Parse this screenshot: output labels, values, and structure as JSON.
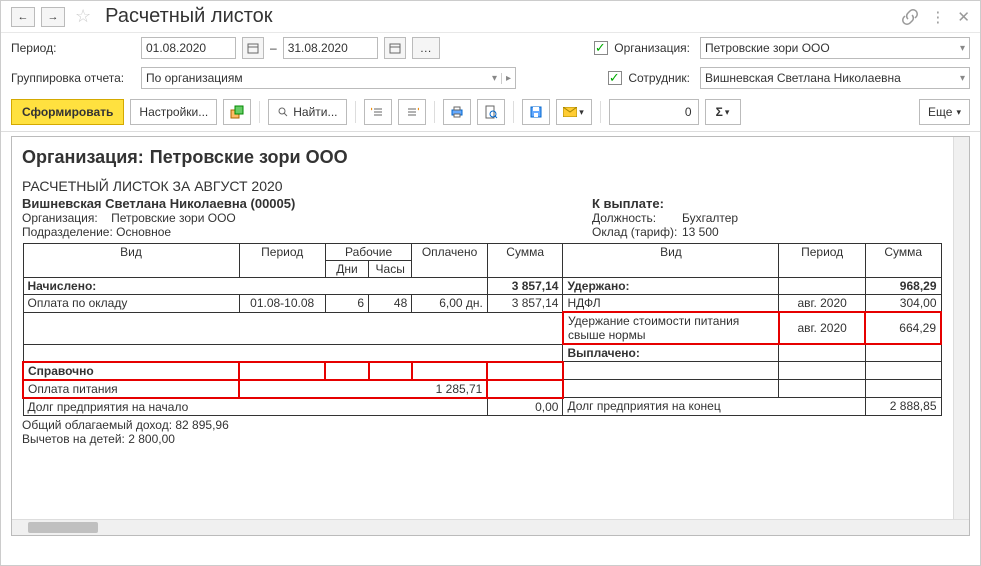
{
  "title": "Расчетный листок",
  "period": {
    "label": "Период:",
    "from": "01.08.2020",
    "to": "31.08.2020",
    "dash": "–"
  },
  "grouping": {
    "label": "Группировка отчета:",
    "value": "По организациям"
  },
  "org_filter": {
    "label": "Организация:",
    "value": "Петровские зори ООО"
  },
  "emp_filter": {
    "label": "Сотрудник:",
    "value": "Вишневская Светлана Николаевна"
  },
  "toolbar": {
    "form": "Сформировать",
    "settings": "Настройки...",
    "find": "Найти...",
    "more": "Еще",
    "num_value": "0"
  },
  "report": {
    "org_header_lbl": "Организация:",
    "org_header_val": "Петровские зори ООО",
    "slip_title": "РАСЧЕТНЫЙ ЛИСТОК ЗА АВГУСТ 2020",
    "employee": "Вишневская Светлана Николаевна (00005)",
    "org_line_lbl": "Организация:",
    "org_line_val": "Петровские зори ООО",
    "dept_lbl": "Подразделение:",
    "dept_val": "Основное",
    "to_pay": "К выплате:",
    "pos_lbl": "Должность:",
    "pos_val": "Бухгалтер",
    "rate_lbl": "Оклад (тариф):",
    "rate_val": "13 500",
    "headers": {
      "kind": "Вид",
      "period": "Период",
      "work": "Рабочие",
      "days": "Дни",
      "hours": "Часы",
      "paid": "Оплачено",
      "sum": "Сумма"
    },
    "accrued": {
      "label": "Начислено:",
      "total": "3 857,14"
    },
    "accrued_rows": [
      {
        "name": "Оплата по окладу",
        "period": "01.08-10.08",
        "days": "6",
        "hours": "48",
        "paid": "6,00 дн.",
        "sum": "3 857,14"
      }
    ],
    "withheld": {
      "label": "Удержано:",
      "total": "968,29"
    },
    "withheld_rows": [
      {
        "name": "НДФЛ",
        "period": "авг. 2020",
        "sum": "304,00"
      },
      {
        "name": "Удержание стоимости питания свыше нормы",
        "period": "авг. 2020",
        "sum": "664,29"
      }
    ],
    "paid_out": "Выплачено:",
    "reference": {
      "label": "Справочно",
      "rows": [
        {
          "name": "Оплата питания",
          "sum": "1 285,71"
        }
      ]
    },
    "debt_start": {
      "label": "Долг предприятия на начало",
      "sum": "0,00"
    },
    "debt_end": {
      "label": "Долг предприятия на конец",
      "sum": "2 888,85"
    },
    "footer": {
      "taxable": "Общий облагаемый доход: 82 895,96",
      "deductions": "Вычетов на детей: 2 800,00"
    }
  }
}
